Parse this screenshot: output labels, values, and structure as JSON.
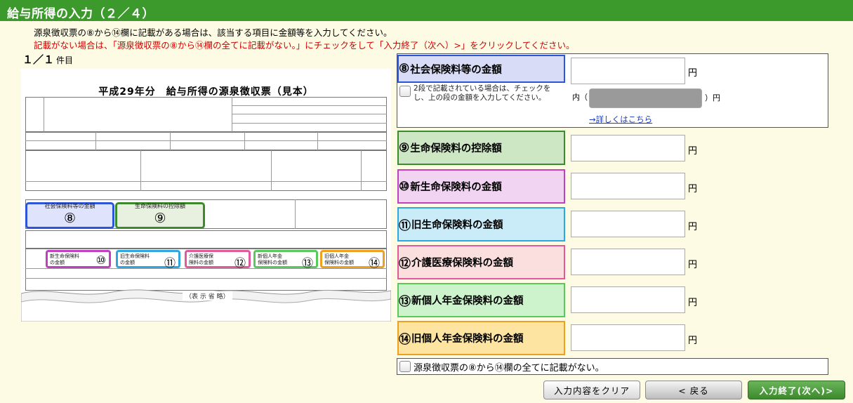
{
  "header": {
    "title": "給与所得の入力（２／４）"
  },
  "instructions": {
    "line1": "源泉徴収票の⑧から⑭欄に記載がある場合は、該当する項目に金額等を入力してください。",
    "line2": "記載がない場合は、「源泉徴収票の⑧から⑭欄の全てに記載がない。」にチェックをして「入力終了（次へ）>」をクリックしてください。"
  },
  "counter": {
    "value": "１／１",
    "suffix": "件目"
  },
  "slip": {
    "title": "平成29年分　給与所得の源泉徴収票（見本）",
    "omitted": "（表 示 省 略）",
    "box8_label": "社会保険料等の金額",
    "box9_label": "生命保険料の控除額",
    "box10_label": "新生命保険料\nの金額",
    "box11_label": "旧生命保険料\nの金額",
    "box12_label": "介護医療保\n険料の金額",
    "box13_label": "新個人年金\n保険料の金額",
    "box14_label": "旧個人年金\n保険料の金額",
    "nums": [
      "⑧",
      "⑨",
      "⑩",
      "⑪",
      "⑫",
      "⑬",
      "⑭"
    ],
    "hl_colors": {
      "8": "#2d55d8",
      "9": "#3c8a2c",
      "10": "#c040c0",
      "11": "#2fa6e0",
      "12": "#e05a9a",
      "13": "#5ac85a",
      "14": "#f0a020"
    }
  },
  "fields": [
    {
      "num": "⑧",
      "label": "社会保険料等の金額",
      "value": "",
      "unit": "円",
      "bg": "#d9dcf7"
    },
    {
      "num": "⑨",
      "label": "生命保険料の控除額",
      "value": "",
      "unit": "円",
      "bg": "#cde6c4"
    },
    {
      "num": "⑩",
      "label": "新生命保険料の金額",
      "value": "",
      "unit": "円",
      "bg": "#f1d4f1"
    },
    {
      "num": "⑪",
      "label": "旧生命保険料の金額",
      "value": "",
      "unit": "円",
      "bg": "#c9ecf8"
    },
    {
      "num": "⑫",
      "label": "介護医療保険料の金額",
      "value": "",
      "unit": "円",
      "bg": "#fbdede"
    },
    {
      "num": "⑬",
      "label": "新個人年金保険料の金額",
      "value": "",
      "unit": "円",
      "bg": "#ccf3cc"
    },
    {
      "num": "⑭",
      "label": "旧個人年金保険料の金額",
      "value": "",
      "unit": "円",
      "bg": "#fde4a0"
    }
  ],
  "note8": {
    "text": "2段で記載されている場合は、チェックをし、上の段の金額を入力してください。",
    "uchi_prefix": "内（",
    "uchi_suffix": "）円",
    "link": "→詳しくはこちら"
  },
  "none_checkbox": {
    "label": "源泉徴収票の⑧から⑭欄の全てに記載がない。"
  },
  "buttons": {
    "clear": "入力内容をクリア",
    "back": "<  戻る",
    "next": "入力終了(次へ)>"
  }
}
